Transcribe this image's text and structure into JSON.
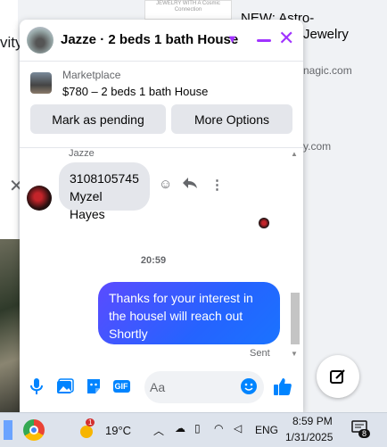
{
  "background": {
    "left_text": "vity",
    "ad_image_text": "JEWELRY WITH A Cosmic Connection",
    "ad_title_line1": "NEW: Astro-",
    "ad_title_line2": "Jewelry",
    "ad_url_1": "nagic.com",
    "ad_url_2": "y.com"
  },
  "chat": {
    "title": "Jazze · 2 beds 1 bath House",
    "marketplace": {
      "label": "Marketplace",
      "listing": "$780 – 2 beds 1 bath House",
      "mark_pending_label": "Mark as pending",
      "more_options_label": "More Options"
    },
    "messages": {
      "sender_name": "Jazze",
      "incoming_line1": "3108105745",
      "incoming_line2": "Myzel Hayes",
      "timestamp": "20:59",
      "outgoing_line1": "Thanks for your interest in",
      "outgoing_line2": "the housel will reach out",
      "outgoing_line3": "Shortly",
      "status": "Sent"
    },
    "composer": {
      "placeholder": "Aa",
      "gif_label": "GIF"
    }
  },
  "taskbar": {
    "weather_badge": "1",
    "temperature": "19°C",
    "language": "ENG",
    "time": "8:59 PM",
    "date": "1/31/2025",
    "notification_count": "8"
  },
  "colors": {
    "accent": "#a033ff",
    "messenger_blue": "#0084ff",
    "bubble_out": "#2563ff",
    "bubble_in": "#e4e6eb"
  }
}
